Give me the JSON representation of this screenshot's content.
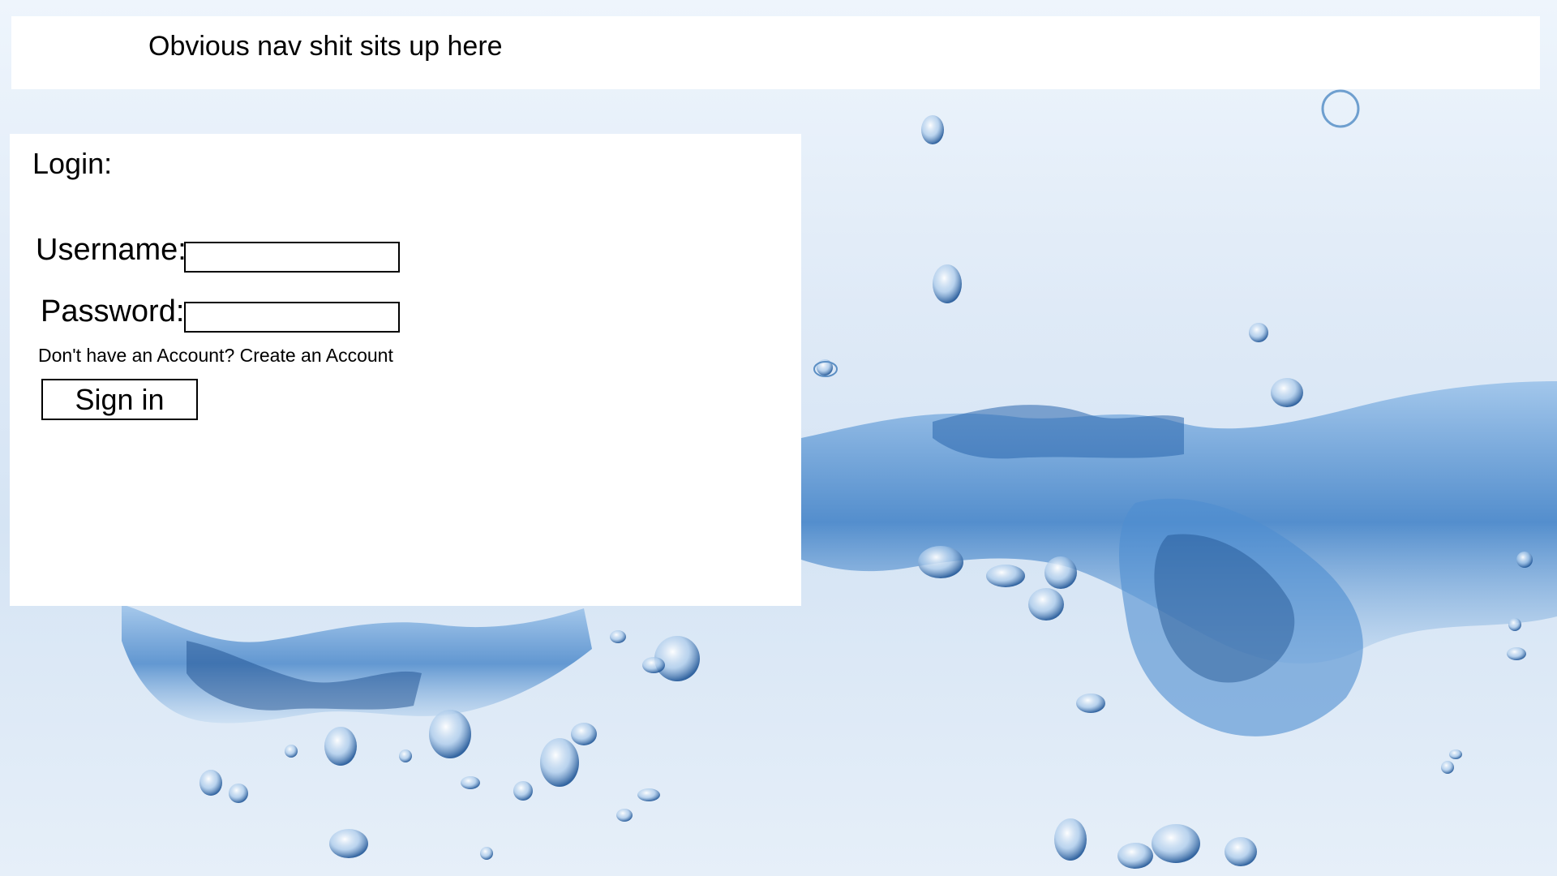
{
  "nav": {
    "text": "Obvious nav shit sits up here"
  },
  "login": {
    "title": "Login:",
    "username_label": "Username:",
    "username_value": "",
    "password_label": "Password:",
    "password_value": "",
    "account_prompt": "Don't have an Account?",
    "create_account_link": "Create an Account",
    "signin_label": "Sign in"
  },
  "background": {
    "description_color_light": "#eef5fc",
    "water_color": "#3f7fc4",
    "water_dark": "#1d4f8f"
  }
}
